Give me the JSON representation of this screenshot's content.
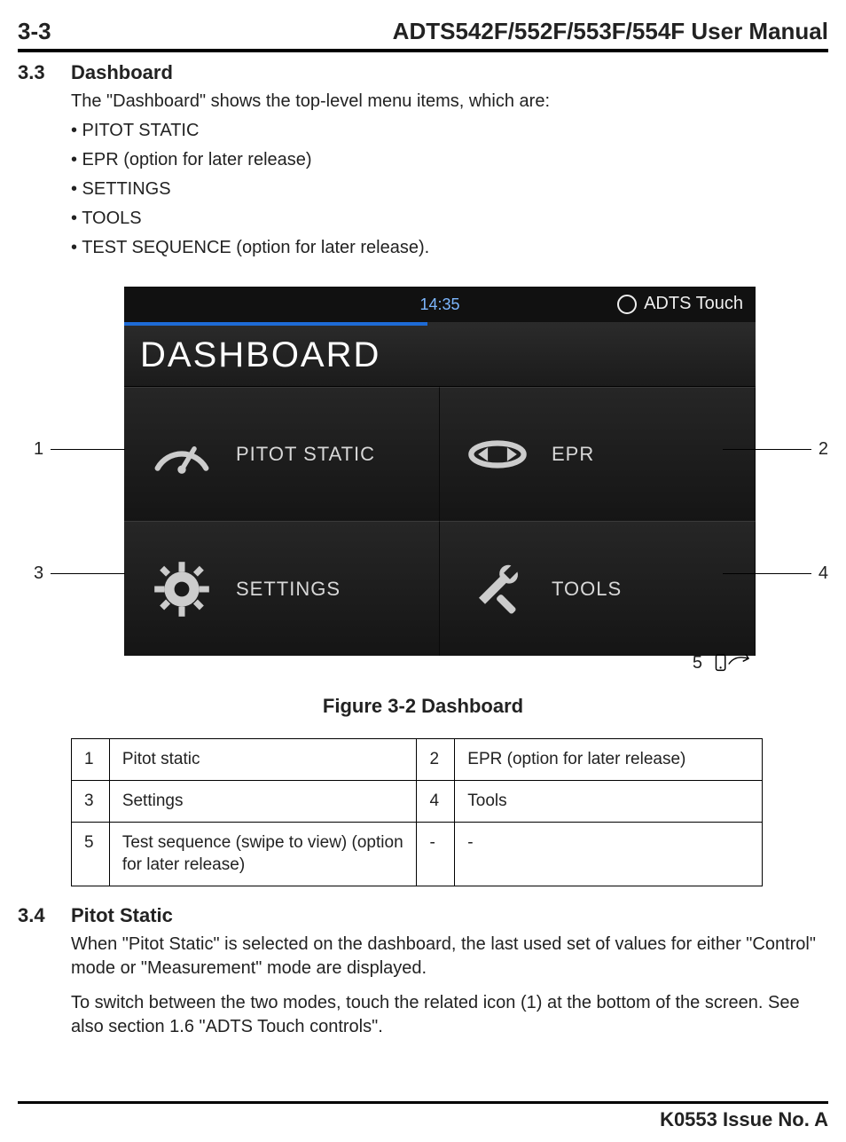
{
  "header": {
    "page_number": "3-3",
    "manual_title": "ADTS542F/552F/553F/554F User Manual"
  },
  "section33": {
    "num": "3.3",
    "title": "Dashboard",
    "intro": "The \"Dashboard\" shows the top-level menu items, which are:",
    "bullets": [
      "• PITOT STATIC",
      "• EPR (option for later release)",
      "• SETTINGS",
      "• TOOLS",
      "• TEST SEQUENCE (option for later release)."
    ]
  },
  "device": {
    "clock": "14:35",
    "brand": "ADTS Touch",
    "screen_title": "DASHBOARD",
    "tiles": {
      "pitot": "PITOT STATIC",
      "epr": "EPR",
      "settings": "SETTINGS",
      "tools": "TOOLS"
    }
  },
  "callouts": {
    "c1": "1",
    "c2": "2",
    "c3": "3",
    "c4": "4",
    "c5": "5"
  },
  "figure_caption": "Figure 3-2 Dashboard",
  "legend": {
    "r1a_n": "1",
    "r1a": "Pitot static",
    "r1b_n": "2",
    "r1b": "EPR (option for later release)",
    "r2a_n": "3",
    "r2a": "Settings",
    "r2b_n": "4",
    "r2b": "Tools",
    "r3a_n": "5",
    "r3a": "Test sequence (swipe to view) (option for later release)",
    "r3b_n": "-",
    "r3b": "-"
  },
  "section34": {
    "num": "3.4",
    "title": "Pitot Static",
    "p1": "When \"Pitot Static\" is selected on the dashboard, the last used set of values for either \"Control\" mode or \"Measurement\" mode are displayed.",
    "p2": "To switch between the two modes, touch the related icon (1) at the bottom of the screen. See also section 1.6 \"ADTS Touch controls\"."
  },
  "footer": {
    "issue": "K0553 Issue No. A"
  }
}
